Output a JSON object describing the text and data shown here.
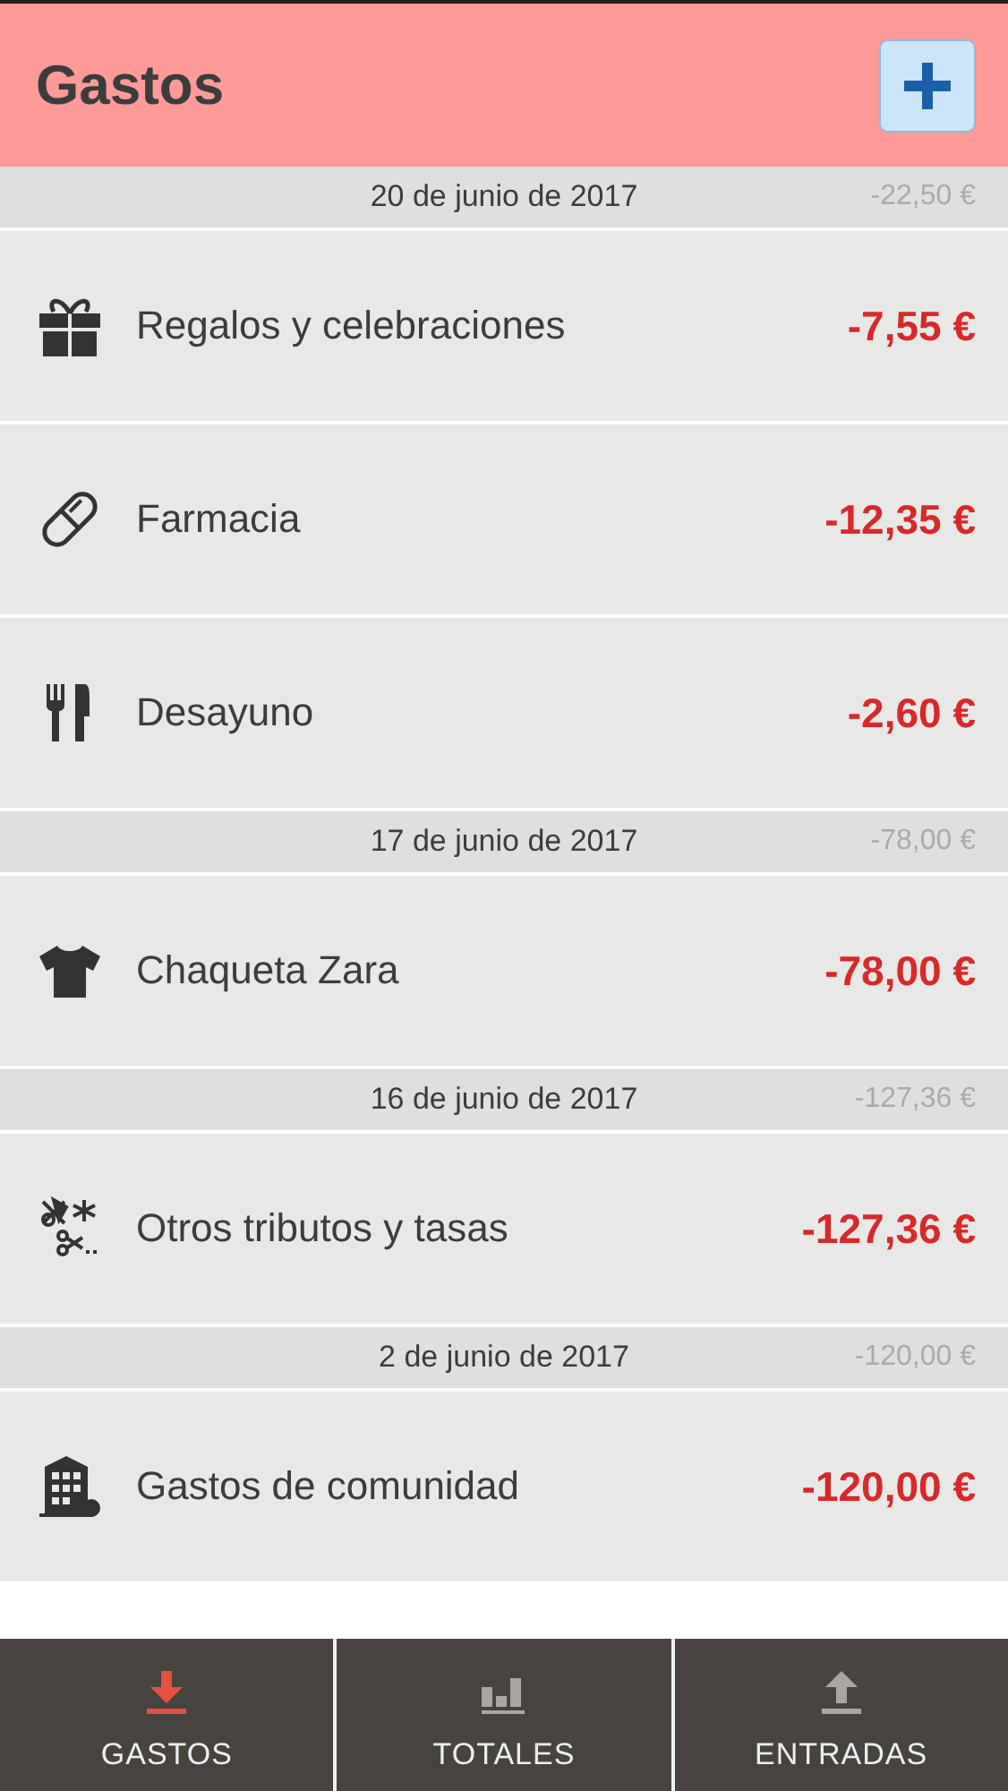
{
  "header": {
    "title": "Gastos"
  },
  "groups": [
    {
      "date": "20 de junio de 2017",
      "total": "-22,50 €",
      "items": [
        {
          "kind": "gift",
          "name": "Regalos y celebraciones",
          "amount": "-7,55 €"
        },
        {
          "kind": "pill",
          "name": "Farmacia",
          "amount": "-12,35 €"
        },
        {
          "kind": "cutlery",
          "name": "Desayuno",
          "amount": "-2,60 €"
        }
      ]
    },
    {
      "date": "17 de junio de 2017",
      "total": "-78,00 €",
      "items": [
        {
          "kind": "shirt",
          "name": "Chaqueta Zara",
          "amount": "-78,00 €"
        }
      ]
    },
    {
      "date": "16 de junio de 2017",
      "total": "-127,36 €",
      "items": [
        {
          "kind": "tools",
          "name": "Otros tributos y tasas",
          "amount": "-127,36 €"
        }
      ]
    },
    {
      "date": "2 de junio de 2017",
      "total": "-120,00 €",
      "items": [
        {
          "kind": "building",
          "name": "Gastos de comunidad",
          "amount": "-120,00 €"
        }
      ]
    }
  ],
  "tabs": [
    {
      "kind": "download",
      "label": "GASTOS",
      "selected": true
    },
    {
      "kind": "chart",
      "label": "TOTALES",
      "selected": false
    },
    {
      "kind": "upload",
      "label": "ENTRADAS",
      "selected": false
    }
  ]
}
